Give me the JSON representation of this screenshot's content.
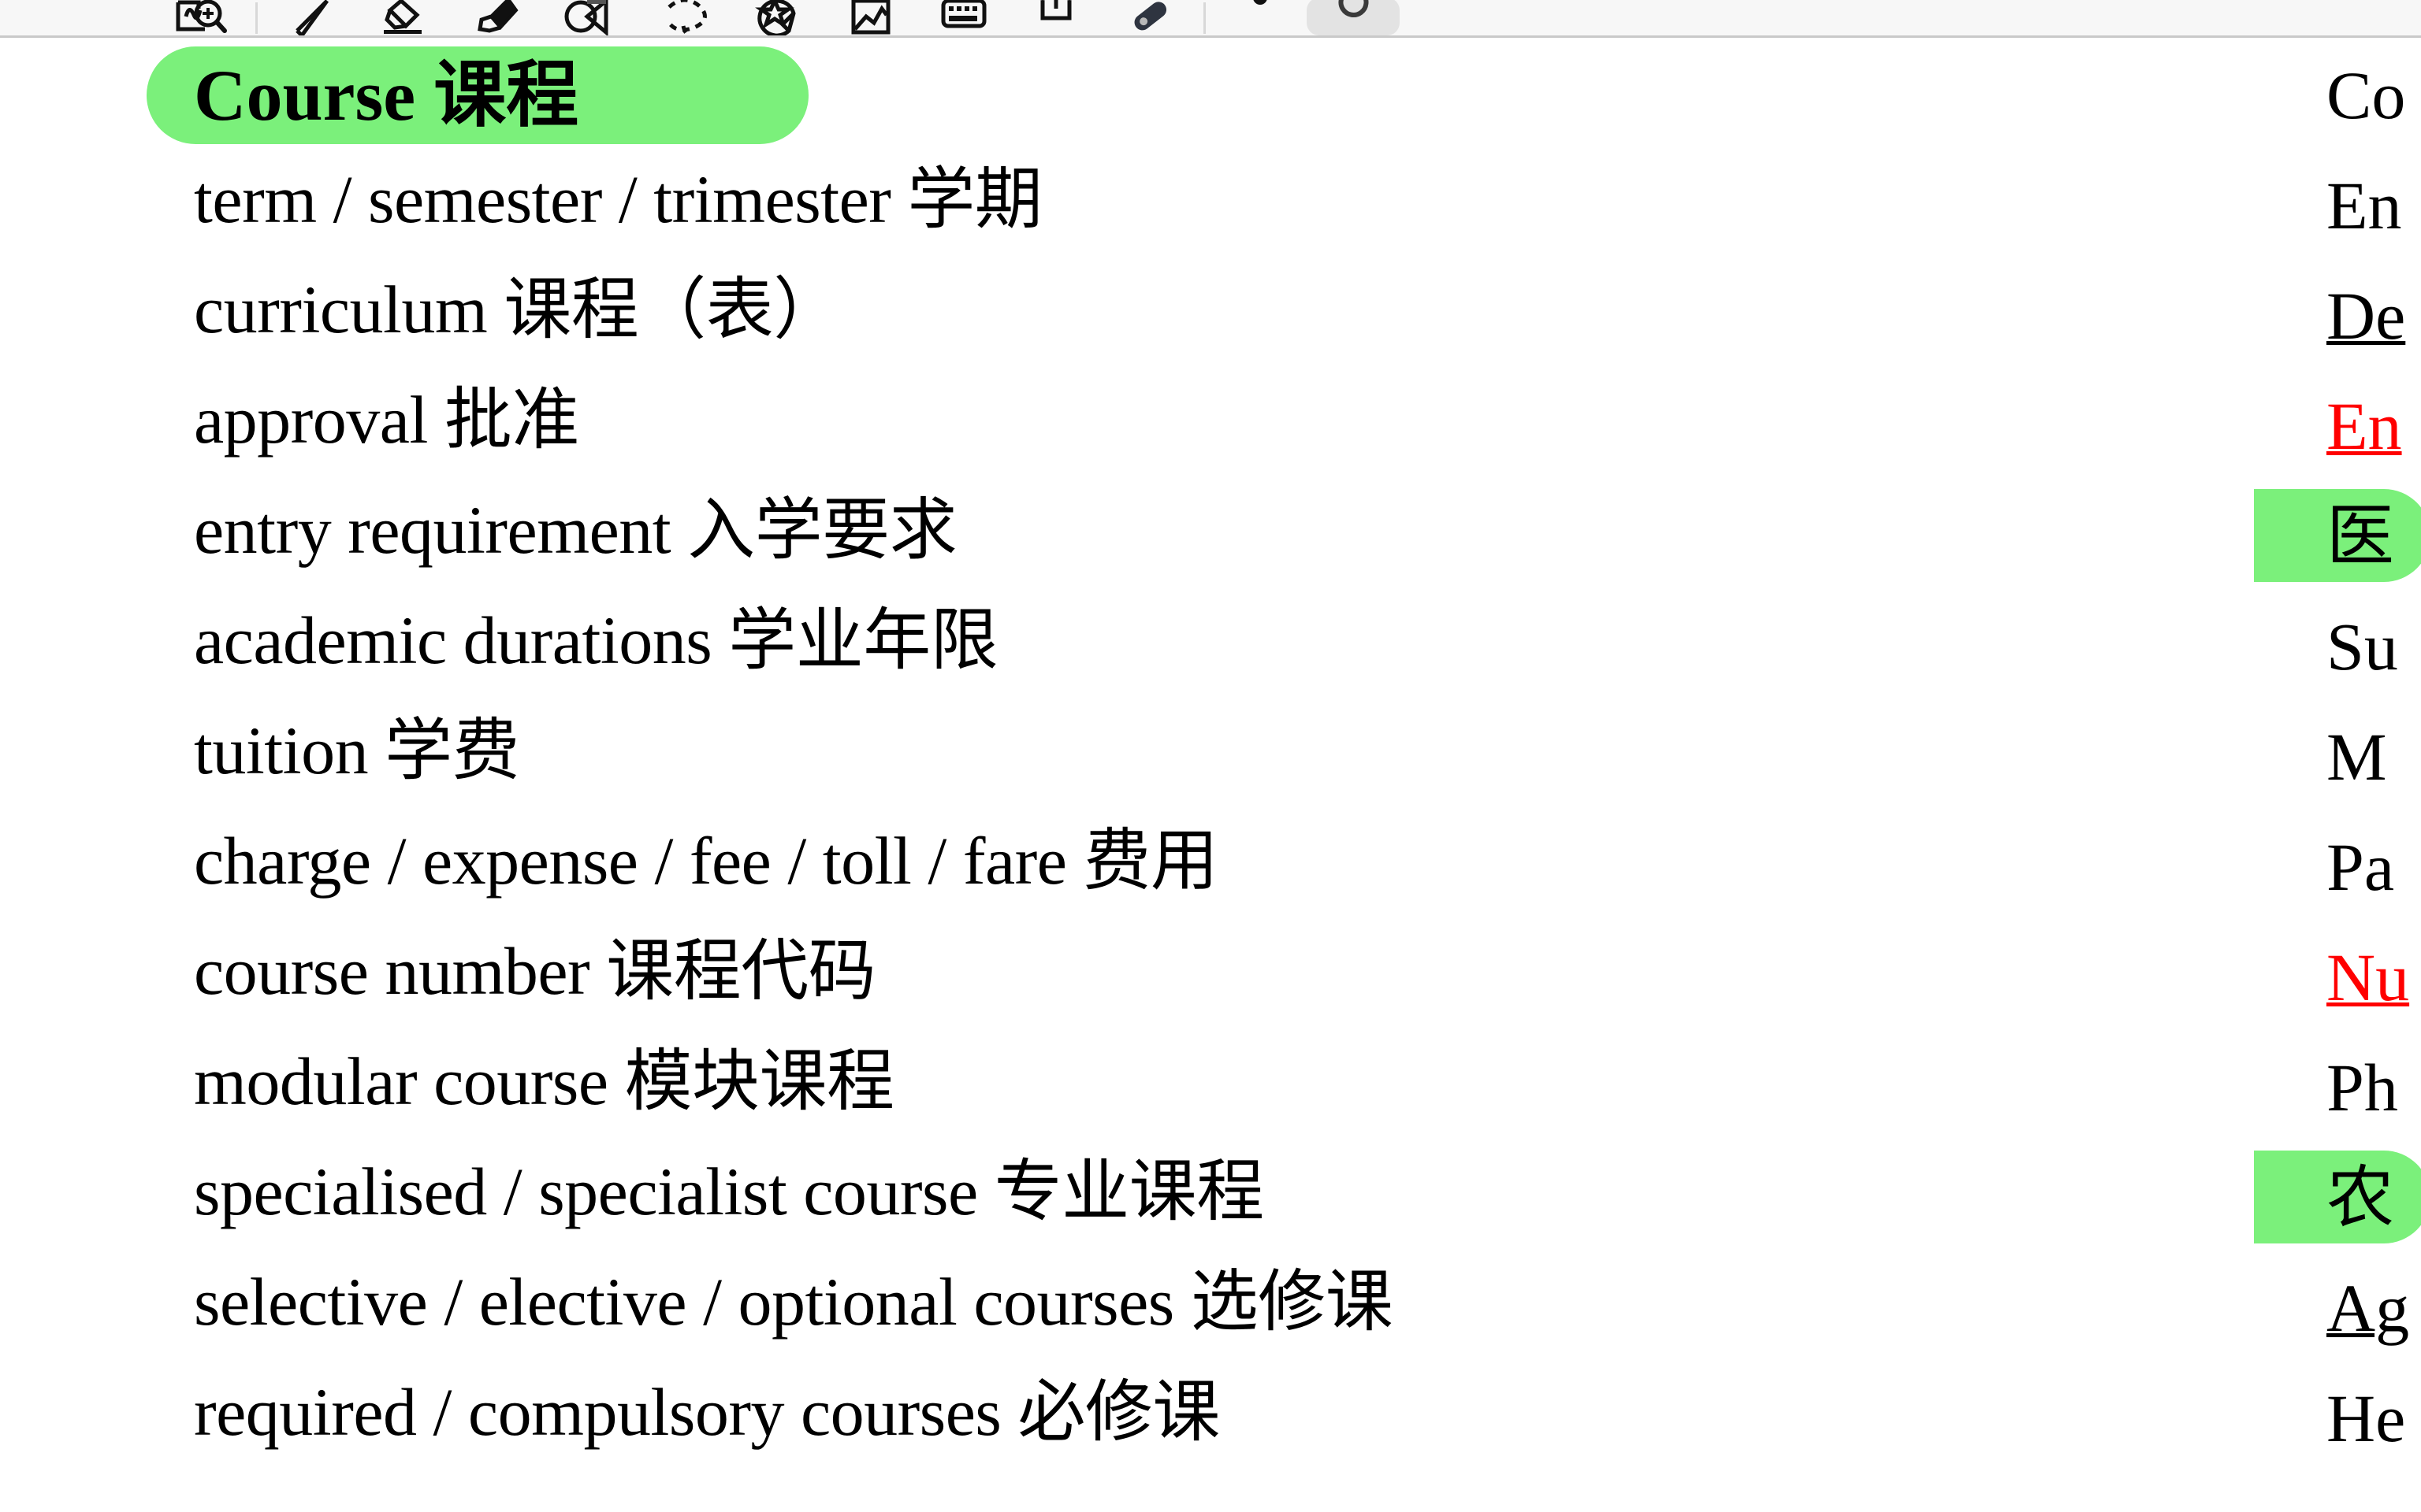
{
  "toolbar": {
    "tools": [
      {
        "name": "snip-zoom-tool",
        "label": "Snip / Zoom",
        "selected": false
      },
      {
        "name": "pen-tool",
        "label": "Pen",
        "selected": false
      },
      {
        "name": "highlighter-tool",
        "label": "Highlighter",
        "selected": false
      },
      {
        "name": "marker-tool",
        "label": "Marker",
        "selected": false
      },
      {
        "name": "shapes-tool",
        "label": "Shapes",
        "selected": false
      },
      {
        "name": "lasso-select-tool",
        "label": "Lasso Select",
        "selected": false
      },
      {
        "name": "sticker-tool",
        "label": "Sticker",
        "selected": false
      },
      {
        "name": "image-tool",
        "label": "Image",
        "selected": false
      },
      {
        "name": "keyboard-tool",
        "label": "Keyboard / Text",
        "selected": false
      },
      {
        "name": "text-box-tool",
        "label": "Text Box",
        "selected": false
      },
      {
        "name": "eraser-tool",
        "label": "Eraser",
        "selected": false
      },
      {
        "name": "color-swatch",
        "label": "Color",
        "selected": false
      },
      {
        "name": "undo-button",
        "label": "Undo",
        "selected": true
      }
    ]
  },
  "document": {
    "heading": "Course 课程",
    "entries": [
      "term / semester / trimester 学期",
      "curriculum 课程（表）",
      "approval 批准",
      "entry requirement 入学要求",
      "academic durations 学业年限",
      "tuition 学费",
      "charge / expense / fee / toll / fare 费用",
      "course number 课程代码",
      "modular course 模块课程",
      "specialised / specialist course 专业课程",
      "selective / elective / optional courses 选修课",
      "required / compulsory courses 必修课"
    ],
    "right_column": [
      {
        "text": "Co",
        "style": "plain"
      },
      {
        "text": "En",
        "style": "plain"
      },
      {
        "text": "De",
        "style": "underline"
      },
      {
        "text": "En",
        "style": "red"
      },
      {
        "text": "医",
        "style": "highlight"
      },
      {
        "text": "Su",
        "style": "plain"
      },
      {
        "text": "M",
        "style": "plain"
      },
      {
        "text": "Pa",
        "style": "plain"
      },
      {
        "text": "Nu",
        "style": "red"
      },
      {
        "text": "Ph",
        "style": "plain"
      },
      {
        "text": "农",
        "style": "highlight"
      },
      {
        "text": "Ag",
        "style": "underline"
      },
      {
        "text": "He",
        "style": "plain"
      }
    ]
  },
  "colors": {
    "highlight_green": "#7bf07b",
    "link_red": "#ff0000",
    "toolbar_bg": "#f7f7f7",
    "selected_tool_bg": "#e3e3e3"
  }
}
